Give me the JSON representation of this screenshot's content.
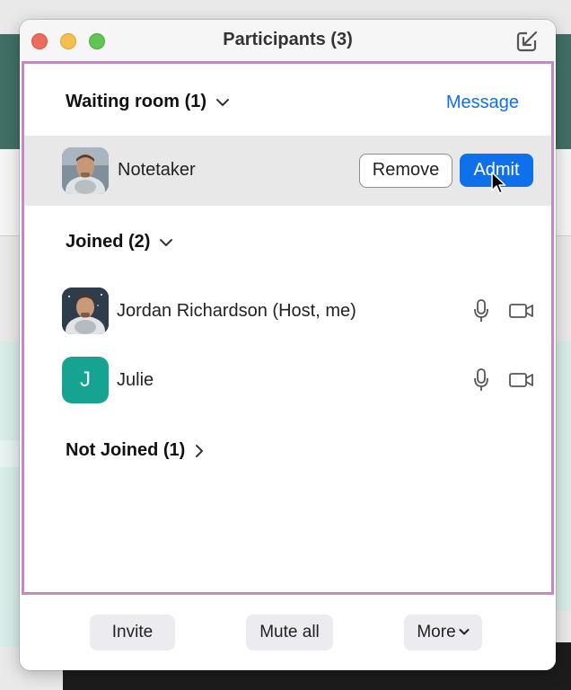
{
  "window": {
    "title": "Participants (3)"
  },
  "waiting_room": {
    "header": "Waiting room (1)",
    "message_link": "Message",
    "participant": {
      "name": "Notetaker",
      "remove_label": "Remove",
      "admit_label": "Admit"
    }
  },
  "joined": {
    "header": "Joined (2)",
    "participants": [
      {
        "name": "Jordan Richardson (Host, me)",
        "avatar": "photo",
        "mic": "mic-icon",
        "camera": "video-icon"
      },
      {
        "name": "Julie",
        "avatar_letter": "J",
        "avatar_color": "#16a392",
        "mic": "mic-icon",
        "camera": "video-icon"
      }
    ]
  },
  "not_joined": {
    "header": "Not Joined (1)"
  },
  "footer": {
    "invite_label": "Invite",
    "mute_all_label": "Mute all",
    "more_label": "More"
  },
  "colors": {
    "accent": "#0e71eb",
    "panel_border": "#c18ac5",
    "waiting_row_bg": "#e8e8e8"
  }
}
